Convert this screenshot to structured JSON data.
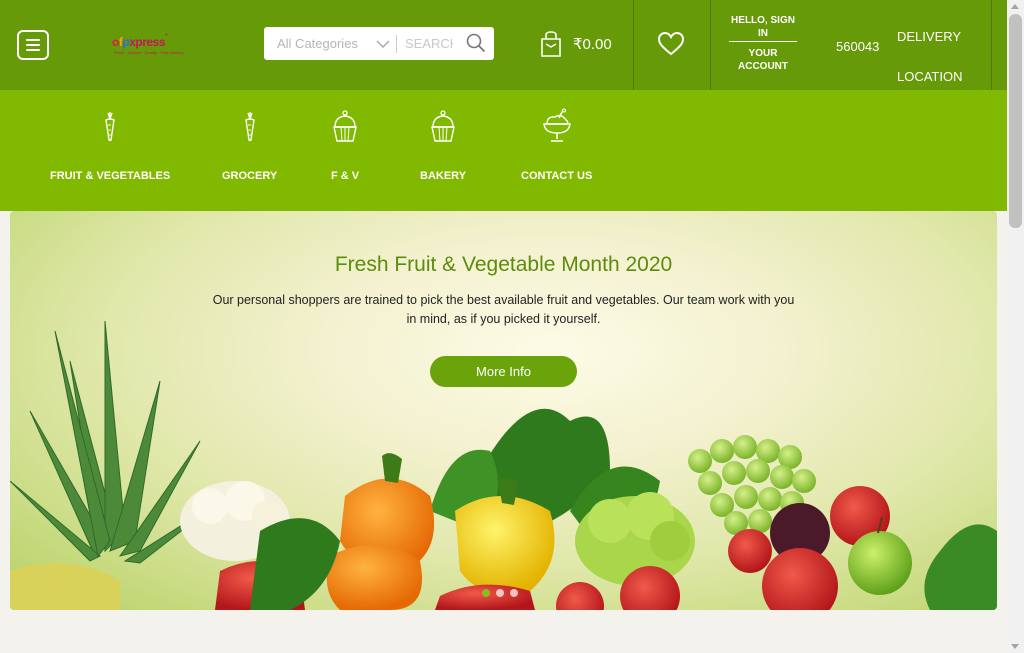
{
  "header": {
    "logo_text": "ofpxpress",
    "logo_tagline": "Fresh · Natural · Quality · Fast Delivery",
    "search": {
      "category": "All Categories",
      "placeholder": "SEARCH"
    },
    "cart_amount": "₹0.00",
    "account": {
      "greeting": "HELLO, SIGN IN",
      "label": "YOUR ACCOUNT"
    },
    "pincode": "560043",
    "delivery": {
      "line1": "DELIVERY",
      "line2": "LOCATION"
    }
  },
  "categories": [
    {
      "label": "FRUIT & VEGETABLES",
      "icon": "carrot-icon"
    },
    {
      "label": "GROCERY",
      "icon": "carrot-icon"
    },
    {
      "label": "F & V",
      "icon": "cupcake-icon"
    },
    {
      "label": "BAKERY",
      "icon": "cupcake-icon"
    },
    {
      "label": "CONTACT US",
      "icon": "ice-cream-icon"
    }
  ],
  "hero": {
    "title": "Fresh Fruit & Vegetable Month 2020",
    "text": "Our personal shoppers are trained to pick the best available fruit and vegetables. Our team work with you in mind, as if you picked it yourself.",
    "button": "More Info",
    "slides": 3,
    "active_slide": 1
  },
  "colors": {
    "header_bg": "#669a09",
    "nav_bg": "#80b900",
    "accent": "#6aa40a",
    "title": "#5c8d0a"
  }
}
